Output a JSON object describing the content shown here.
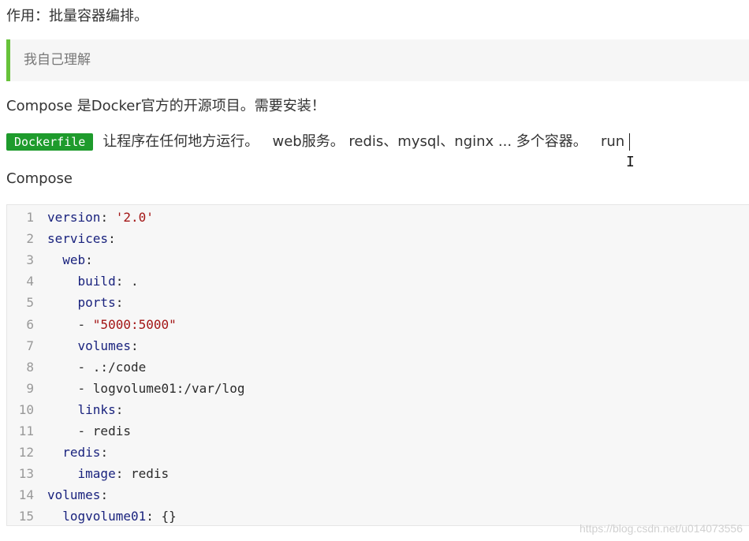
{
  "intro": "作用：批量容器编排。",
  "quote": "我自己理解",
  "compose_desc": "Compose 是Docker官方的开源项目。需要安装！",
  "line4": {
    "tag": "Dockerfile",
    "text": "让程序在任何地方运行。   web服务。 redis、mysql、nginx ... 多个容器。   run"
  },
  "compose_label": "Compose",
  "code": {
    "lines": [
      {
        "n": "1",
        "indent": "",
        "key": "version",
        "colon": ":",
        "val": " '2.0'",
        "val_type": "string"
      },
      {
        "n": "2",
        "indent": "",
        "key": "services",
        "colon": ":",
        "val": "",
        "val_type": "plain"
      },
      {
        "n": "3",
        "indent": "  ",
        "key": "web",
        "colon": ":",
        "val": "",
        "val_type": "plain"
      },
      {
        "n": "4",
        "indent": "    ",
        "key": "build",
        "colon": ":",
        "val": " .",
        "val_type": "plain"
      },
      {
        "n": "5",
        "indent": "    ",
        "key": "ports",
        "colon": ":",
        "val": "",
        "val_type": "plain"
      },
      {
        "n": "6",
        "indent": "    ",
        "key": "",
        "colon": "",
        "val": "- \"5000:5000\"",
        "val_type": "string-dash"
      },
      {
        "n": "7",
        "indent": "    ",
        "key": "volumes",
        "colon": ":",
        "val": "",
        "val_type": "plain"
      },
      {
        "n": "8",
        "indent": "    ",
        "key": "",
        "colon": "",
        "val": "- .:/code",
        "val_type": "plain"
      },
      {
        "n": "9",
        "indent": "    ",
        "key": "",
        "colon": "",
        "val": "- logvolume01:/var/log",
        "val_type": "plain"
      },
      {
        "n": "10",
        "indent": "    ",
        "key": "links",
        "colon": ":",
        "val": "",
        "val_type": "plain"
      },
      {
        "n": "11",
        "indent": "    ",
        "key": "",
        "colon": "",
        "val": "- redis",
        "val_type": "plain"
      },
      {
        "n": "12",
        "indent": "  ",
        "key": "redis",
        "colon": ":",
        "val": "",
        "val_type": "plain"
      },
      {
        "n": "13",
        "indent": "    ",
        "key": "image",
        "colon": ":",
        "val": " redis",
        "val_type": "plain"
      },
      {
        "n": "14",
        "indent": "",
        "key": "volumes",
        "colon": ":",
        "val": "",
        "val_type": "plain"
      },
      {
        "n": "15",
        "indent": "  ",
        "key": "logvolume01",
        "colon": ":",
        "val": " {}",
        "val_type": "plain"
      }
    ]
  },
  "watermark": "https://blog.csdn.net/u014073556",
  "colors": {
    "quote_border": "#67c23a",
    "tag_bg": "#1e9b2c",
    "code_key": "#1a237e",
    "code_string": "#a31515"
  }
}
